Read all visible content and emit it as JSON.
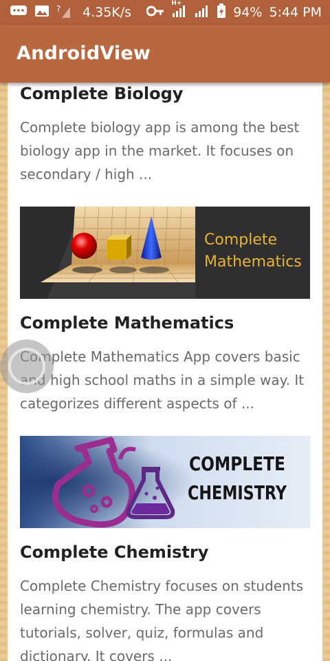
{
  "status_bar": {
    "network_speed": "4.35K/s",
    "network_type": "H+",
    "battery": "94%",
    "time": "5:44 PM",
    "icons": [
      "message-icon",
      "image-icon",
      "signal-question-icon",
      "key-icon",
      "signal-icon",
      "signal-icon-2",
      "battery-icon"
    ]
  },
  "app_bar": {
    "title": "AndroidView"
  },
  "posts": [
    {
      "title": "Complete Biology",
      "description": "Complete biology app is among the best biology app in the market. It focuses on secondary / high ..."
    },
    {
      "title": "Complete Mathematics",
      "description": "Complete Mathematics App covers basic and high school maths in a simple way. It categorizes different aspects of ...",
      "banner": {
        "line1": "Complete",
        "line2": "Mathematics"
      }
    },
    {
      "title": "Complete Chemistry",
      "description": "Complete Chemistry focuses on students learning chemistry. The app covers tutorials, solver, quiz, formulas and dictionary. It covers ...",
      "banner": {
        "line1": "COMPLETE",
        "line2": "CHEMISTRY"
      }
    }
  ],
  "colors": {
    "status_bar": "#b0603b",
    "app_bar": "#b9673f",
    "background": "#e9c48d",
    "title_text": "#222222",
    "body_text": "#6a6a6a"
  }
}
